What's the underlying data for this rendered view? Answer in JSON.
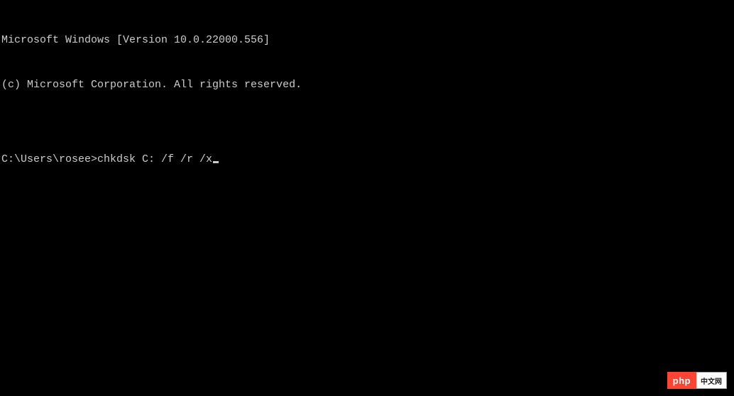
{
  "terminal": {
    "header_line1": "Microsoft Windows [Version 10.0.22000.556]",
    "header_line2": "(c) Microsoft Corporation. All rights reserved.",
    "blank": "",
    "prompt": "C:\\Users\\rosee>",
    "command": "chkdsk C: /f /r /x"
  },
  "watermark": {
    "left": "php",
    "right": "中文网"
  }
}
